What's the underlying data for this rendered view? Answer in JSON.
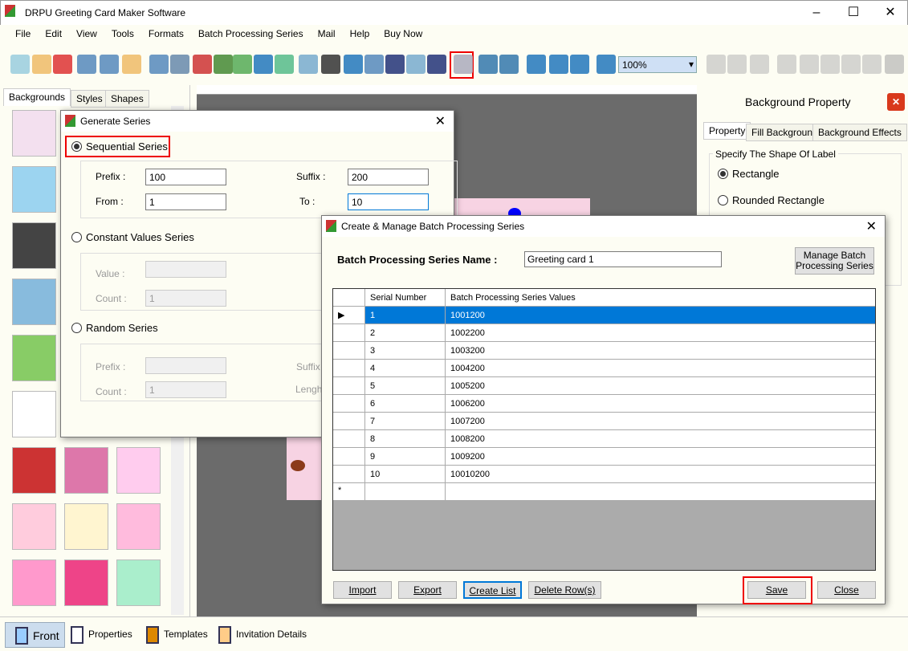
{
  "app": {
    "title": "DRPU Greeting Card Maker Software"
  },
  "menu": [
    "File",
    "Edit",
    "View",
    "Tools",
    "Formats",
    "Batch Processing Series",
    "Mail",
    "Help",
    "Buy Now"
  ],
  "toolbar": {
    "zoom": "100%",
    "icons": [
      "new-icon",
      "open-icon",
      "close-icon",
      "save-icon",
      "save-as-icon",
      "export-icon",
      "page-icon",
      "print-icon",
      "copy-icon",
      "background-icon",
      "image-icon",
      "pen-icon",
      "shapes-icon",
      "watermark-icon",
      "barcode-icon",
      "text-icon",
      "text-page-icon",
      "signature-icon",
      "mail-icon",
      "line-icon",
      "batch-series-icon",
      "rotate-left-icon",
      "rotate-right-icon",
      "grid-icon",
      "actual-size-icon",
      "fit-icon",
      "zoom-in-icon",
      "zoom-out-icon",
      "lock-icon",
      "unlock-icon",
      "arrow-left-icon",
      "flip-icon",
      "arrow-right-icon",
      "arrow-up-icon",
      "align-icon",
      "arrow-down-icon"
    ]
  },
  "left_tabs": [
    "Backgrounds",
    "Styles",
    "Shapes"
  ],
  "right_panel": {
    "title": "Background Property",
    "tabs": [
      "Property",
      "Fill Background",
      "Background Effects"
    ],
    "group": "Specify The Shape Of Label",
    "options": [
      "Rectangle",
      "Rounded Rectangle"
    ]
  },
  "bottom": [
    "Front",
    "Properties",
    "Templates",
    "Invitation Details"
  ],
  "generate": {
    "title": "Generate Series",
    "sequential": "Sequential Series",
    "prefix_label": "Prefix :",
    "prefix": "100",
    "suffix_label": "Suffix :",
    "suffix": "200",
    "from_label": "From :",
    "from": "1",
    "to_label": "To :",
    "to": "10",
    "constant": "Constant Values Series",
    "value_label": "Value :",
    "count_label": "Count :",
    "count": "1",
    "random": "Random Series",
    "r_prefix_label": "Prefix :",
    "r_suffix_label": "Suffix",
    "r_count_label": "Count :",
    "r_count": "1",
    "r_length_label": "Lengh"
  },
  "batch": {
    "title": "Create & Manage Batch Processing Series",
    "name_label": "Batch Processing Series Name :",
    "name": "Greeting card 1",
    "manage": "Manage  Batch Processing Series",
    "columns": [
      "Serial Number",
      "Batch Processing Series Values"
    ],
    "rows": [
      [
        "1",
        "1001200"
      ],
      [
        "2",
        "1002200"
      ],
      [
        "3",
        "1003200"
      ],
      [
        "4",
        "1004200"
      ],
      [
        "5",
        "1005200"
      ],
      [
        "6",
        "1006200"
      ],
      [
        "7",
        "1007200"
      ],
      [
        "8",
        "1008200"
      ],
      [
        "9",
        "1009200"
      ],
      [
        "10",
        "10010200"
      ]
    ],
    "new_row": "*",
    "buttons": {
      "import": "Import",
      "export": "Export",
      "create": "Create List",
      "delete": "Delete Row(s)",
      "save": "Save",
      "close": "Close"
    }
  },
  "colors": {
    "selection": "#0078d7",
    "highlight": "#e00000",
    "panel": "#fdfdf3"
  }
}
